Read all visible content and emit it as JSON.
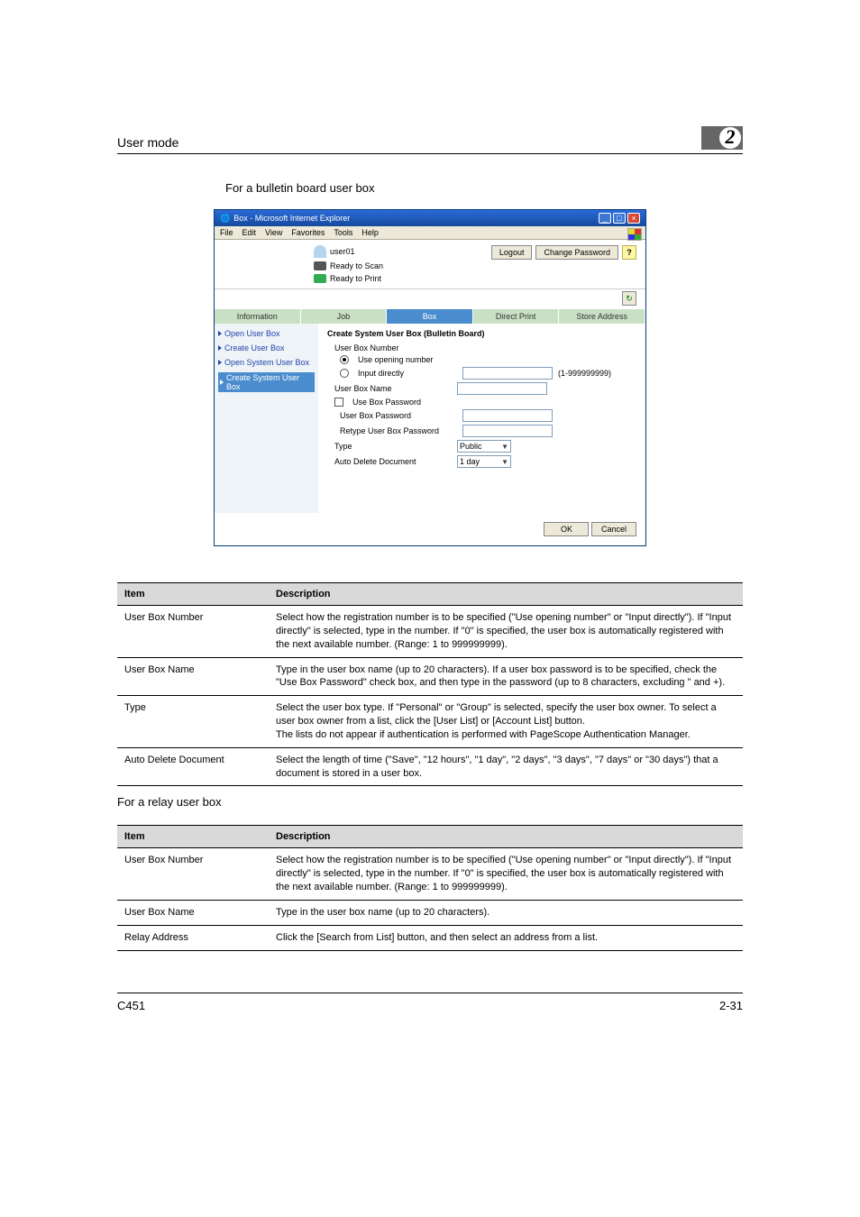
{
  "header": {
    "left": "User mode",
    "chapter": "2"
  },
  "subhead": "For a bulletin board user box",
  "ie": {
    "title": "Box - Microsoft Internet Explorer",
    "menu": {
      "file": "File",
      "edit": "Edit",
      "view": "View",
      "favorites": "Favorites",
      "tools": "Tools",
      "help": "Help"
    },
    "user": "user01",
    "status_scan": "Ready to Scan",
    "status_print": "Ready to Print",
    "logout": "Logout",
    "change_pw": "Change Password",
    "qmark": "?",
    "refresh": "↻",
    "tabs": {
      "info": "Information",
      "job": "Job",
      "box": "Box",
      "direct": "Direct Print",
      "store": "Store Address"
    },
    "sidenav": {
      "open_user": "Open User Box",
      "create_user": "Create User Box",
      "open_sys": "Open System User Box",
      "create_sys": "Create System User Box"
    },
    "form": {
      "title": "Create System User Box (Bulletin Board)",
      "num_label": "User Box Number",
      "opt_opening": "Use opening number",
      "opt_direct": "Input directly",
      "num_range": "(1-999999999)",
      "name_label": "User Box Name",
      "use_pw": "Use Box Password",
      "pw_label": "User Box Password",
      "pw_re_label": "Retype User Box Password",
      "type_label": "Type",
      "type_value": "Public",
      "auto_label": "Auto Delete Document",
      "auto_value": "1 day",
      "ok": "OK",
      "cancel": "Cancel"
    }
  },
  "table1": {
    "head_item": "Item",
    "head_desc": "Description",
    "rows": [
      {
        "item": "User Box Number",
        "desc": "Select how the registration number is to be specified (\"Use opening number\" or \"Input directly\"). If \"Input directly\" is selected, type in the number. If \"0\" is specified, the user box is automatically registered with the next available number. (Range: 1 to 999999999)."
      },
      {
        "item": "User Box Name",
        "desc": "Type in the user box name (up to 20 characters). If a user box password is to be specified, check the \"Use Box Password\" check box, and then type in the password (up to 8 characters, excluding \" and +)."
      },
      {
        "item": "Type",
        "desc": "Select the user box type. If \"Personal\" or \"Group\" is selected, specify the user box owner. To select a user box owner from a list, click the [User List] or [Account List] button.\nThe lists do not appear if authentication is performed with PageScope Authentication Manager."
      },
      {
        "item": "Auto Delete Document",
        "desc": "Select the length of time (\"Save\", \"12 hours\", \"1 day\", \"2 days\", \"3 days\", \"7 days\" or \"30 days\") that a document is stored in a user box."
      }
    ]
  },
  "relay_head": "For a relay user box",
  "table2": {
    "head_item": "Item",
    "head_desc": "Description",
    "rows": [
      {
        "item": "User Box Number",
        "desc": "Select how the registration number is to be specified (\"Use opening number\" or \"Input directly\"). If \"Input directly\" is selected, type in the number. If \"0\" is specified, the user box is automatically registered with the next available number. (Range: 1 to 999999999)."
      },
      {
        "item": "User Box Name",
        "desc": "Type in the user box name (up to 20 characters)."
      },
      {
        "item": "Relay Address",
        "desc": "Click the [Search from List] button, and then select an address from a list."
      }
    ]
  },
  "footer": {
    "left": "C451",
    "right": "2-31"
  }
}
